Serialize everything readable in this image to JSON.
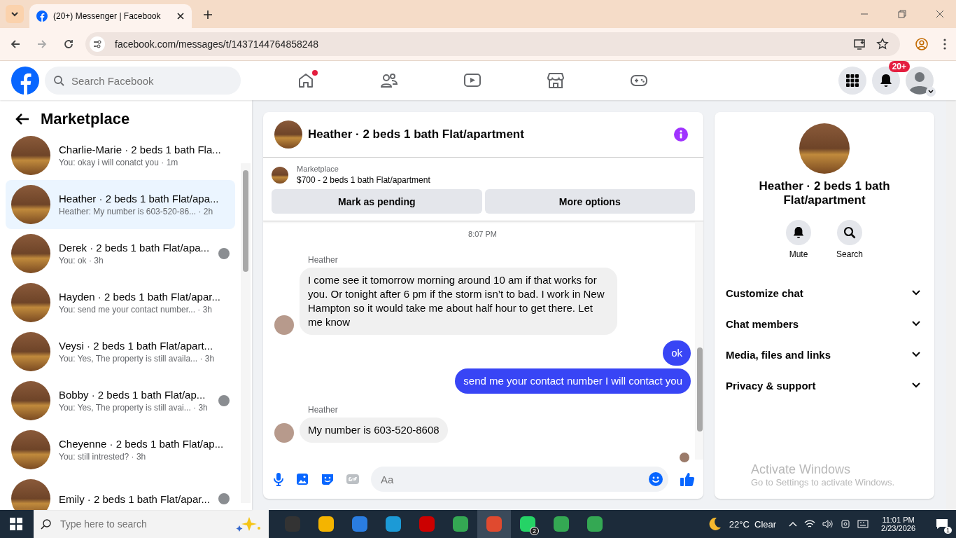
{
  "browser": {
    "tab_title": "(20+) Messenger | Facebook",
    "url": "facebook.com/messages/t/1437144764858248"
  },
  "header": {
    "search_placeholder": "Search Facebook",
    "nav": [
      {
        "kind": "home",
        "dot": true
      },
      {
        "kind": "friends",
        "dot": false
      },
      {
        "kind": "video",
        "dot": false
      },
      {
        "kind": "marketplace",
        "dot": false
      },
      {
        "kind": "gaming",
        "dot": false
      }
    ],
    "notification_badge": "20+"
  },
  "sidebar": {
    "title": "Marketplace",
    "conversations": [
      {
        "name": "Charlie-Marie · 2 beds 1 bath Fla...",
        "preview": "You: okay i will conatct you · 1m",
        "selected": false,
        "seen_avatar": false
      },
      {
        "name": "Heather · 2 beds 1 bath Flat/apa...",
        "preview": "Heather: My number is 603-520-86... · 2h",
        "selected": true,
        "seen_avatar": false
      },
      {
        "name": "Derek · 2 beds 1 bath Flat/apa...",
        "preview": "You: ok · 3h",
        "selected": false,
        "seen_avatar": true
      },
      {
        "name": "Hayden · 2 beds 1 bath Flat/apar...",
        "preview": "You: send me your contact number... · 3h",
        "selected": false,
        "seen_avatar": false
      },
      {
        "name": "Veysi · 2 beds 1 bath Flat/apart...",
        "preview": "You: Yes, The property is still availa... · 3h",
        "selected": false,
        "seen_avatar": false
      },
      {
        "name": "Bobby · 2 beds 1 bath Flat/ap...",
        "preview": "You: Yes, The property is still avai... · 3h",
        "selected": false,
        "seen_avatar": true
      },
      {
        "name": "Cheyenne · 2 beds 1 bath Flat/ap...",
        "preview": "You: still intrested? · 3h",
        "selected": false,
        "seen_avatar": false
      },
      {
        "name": "Emily · 2 beds 1 bath Flat/apar...",
        "selected": false,
        "seen_avatar": true
      }
    ]
  },
  "chat": {
    "title": "Heather · 2 beds 1 bath Flat/apartment",
    "listing_label": "Marketplace",
    "listing": "$700 - 2 beds 1 bath Flat/apartment",
    "buttons": [
      "Mark as pending",
      "More options"
    ],
    "timestamp": "8:07 PM",
    "messages": [
      {
        "kind": "received",
        "sender": "Heather",
        "text": "I come see it tomorrow morning around 10 am if that works for you. Or tonight after 6 pm if the storm isn’t to bad. I work in New Hampton so it would take me about half hour to get there. Let me know"
      },
      {
        "kind": "sent",
        "text": "ok"
      },
      {
        "kind": "sent",
        "text": "send me your contact number I will contact you"
      },
      {
        "kind": "received",
        "sender": "Heather",
        "text": "My number is 603-520-8608"
      }
    ],
    "composer_placeholder": "Aa"
  },
  "info": {
    "title": "Heather · 2 beds 1 bath Flat/apartment",
    "actions": [
      {
        "kind": "mute",
        "label": "Mute"
      },
      {
        "kind": "search",
        "label": "Search"
      }
    ],
    "sections": [
      "Customize chat",
      "Chat members",
      "Media, files and links",
      "Privacy & support"
    ]
  },
  "activation": {
    "title": "Activate Windows",
    "text": "Go to Settings to activate Windows."
  },
  "taskbar": {
    "search_placeholder": "Type here to search",
    "apps": [
      {
        "kind": "taskview",
        "selected": false
      },
      {
        "kind": "explorer",
        "selected": false
      },
      {
        "kind": "store",
        "selected": false
      },
      {
        "kind": "edge",
        "selected": false
      },
      {
        "kind": "game",
        "selected": false
      },
      {
        "kind": "chrome",
        "selected": false
      },
      {
        "kind": "tool",
        "selected": true
      },
      {
        "kind": "whatsapp",
        "selected": false,
        "badge": "2"
      },
      {
        "kind": "chrome",
        "selected": false
      },
      {
        "kind": "chrome",
        "selected": false
      }
    ],
    "weather": "22°C  Clear",
    "time": "11:01 PM",
    "date": "2/23/2026",
    "notification_count": "1"
  }
}
